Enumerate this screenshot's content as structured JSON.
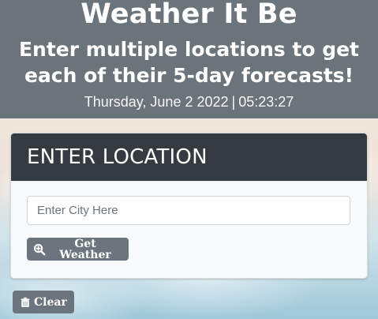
{
  "header": {
    "title": "Weather It Be",
    "subtitle": "Enter multiple locations to get each of their 5-day forecasts!",
    "date": "Thursday, June 2 2022",
    "separator": "|",
    "time": "05:23:27"
  },
  "card": {
    "header_label": "ENTER LOCATION",
    "city_input": {
      "value": "",
      "placeholder": "Enter City Here"
    },
    "get_weather_label": "Get Weather",
    "get_weather_icon": "search-plus-icon"
  },
  "actions": {
    "clear_label": "Clear",
    "clear_icon": "trash-icon"
  },
  "colors": {
    "header_bg": "#6b737b",
    "card_header_bg": "#343a40",
    "button_bg": "#6c757d"
  }
}
